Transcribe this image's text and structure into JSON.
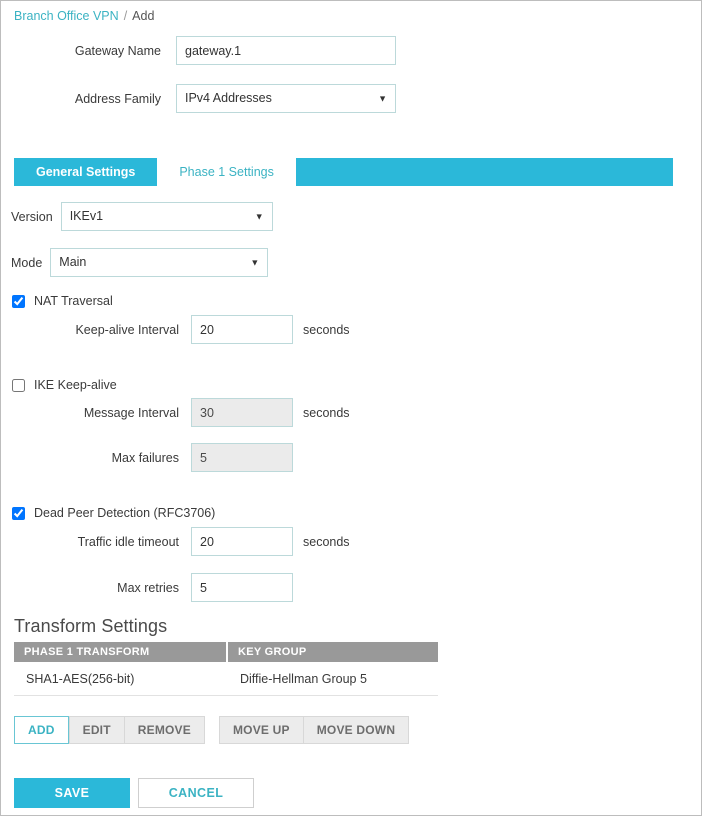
{
  "breadcrumb": {
    "link": "Branch Office VPN",
    "separator": "/",
    "current": "Add"
  },
  "form": {
    "gateway_name": {
      "label": "Gateway Name",
      "value": "gateway.1"
    },
    "address_family": {
      "label": "Address Family",
      "value": "IPv4 Addresses",
      "arrow": "▼"
    }
  },
  "tabs": [
    {
      "label": "General Settings",
      "active": false
    },
    {
      "label": "Phase 1 Settings",
      "active": true
    }
  ],
  "phase1": {
    "version": {
      "label": "Version",
      "value": "IKEv1",
      "arrow": "▼"
    },
    "mode": {
      "label": "Mode",
      "value": "Main",
      "arrow": "▼"
    },
    "nat_traversal": {
      "label": "NAT Traversal",
      "checked": true,
      "keep_alive_interval": {
        "label": "Keep-alive Interval",
        "value": "20",
        "unit": "seconds"
      }
    },
    "ike_keep_alive": {
      "label": "IKE Keep-alive",
      "checked": false,
      "message_interval": {
        "label": "Message Interval",
        "value": "30",
        "unit": "seconds"
      },
      "max_failures": {
        "label": "Max failures",
        "value": "5"
      }
    },
    "dead_peer_detection": {
      "label": "Dead Peer Detection (RFC3706)",
      "checked": true,
      "traffic_idle_timeout": {
        "label": "Traffic idle timeout",
        "value": "20",
        "unit": "seconds"
      },
      "max_retries": {
        "label": "Max retries",
        "value": "5"
      }
    }
  },
  "transform_settings": {
    "title": "Transform Settings",
    "columns": [
      "PHASE 1 TRANSFORM",
      "KEY GROUP"
    ],
    "rows": [
      {
        "phase1_transform": "SHA1-AES(256-bit)",
        "key_group": "Diffie-Hellman Group 5"
      }
    ],
    "buttons": [
      {
        "label": "ADD",
        "style": "primary"
      },
      {
        "label": "EDIT",
        "style": "muted"
      },
      {
        "label": "REMOVE",
        "style": "muted"
      },
      {
        "label": "MOVE UP",
        "style": "muted"
      },
      {
        "label": "MOVE DOWN",
        "style": "muted"
      }
    ]
  },
  "footer": {
    "save": "SAVE",
    "cancel": "CANCEL"
  },
  "colors": {
    "accent_teal": "#2bb8d9",
    "link_teal": "#3bb3c3",
    "header_grey": "#999999",
    "field_border": "#bcd9da",
    "disabled_fill": "#ebebeb"
  }
}
